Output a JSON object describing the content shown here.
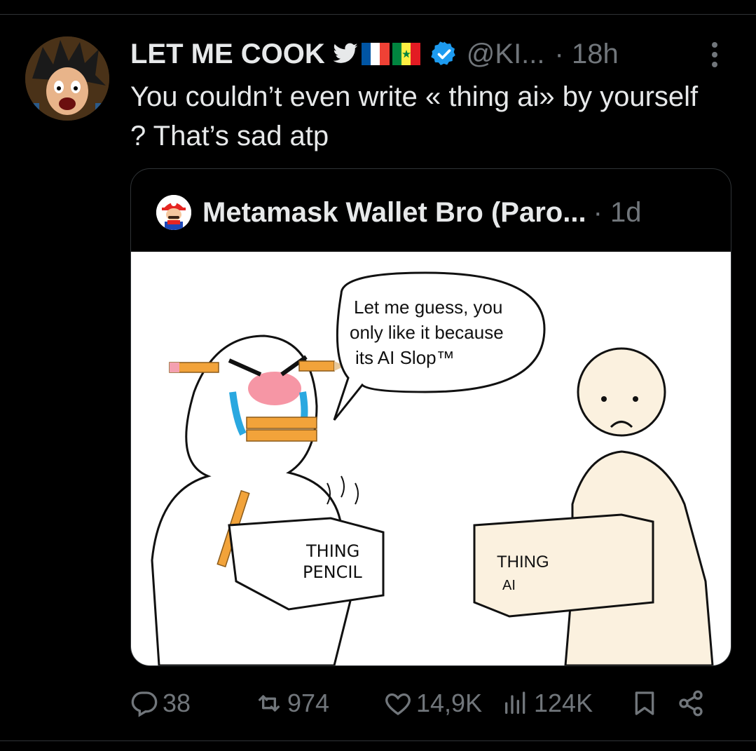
{
  "post": {
    "author_name": "LET ME COOK",
    "handle": "@KI...",
    "time": "· 18h",
    "text": "You couldn’t even write « thing ai» by yourself ? That’s sad atp"
  },
  "quote": {
    "author_name": "Metamask Wallet Bro (Paro...",
    "time": "· 1d",
    "comic": {
      "speech": [
        "Let me guess, you",
        "only like it because",
        "its AI Slop™"
      ],
      "left_box_line1": "THING",
      "left_box_line2": "PENCIL",
      "right_box_line1": "THING",
      "right_box_line2": "AI"
    }
  },
  "actions": {
    "replies": "38",
    "reposts": "974",
    "likes": "14,9K",
    "views": "124K"
  },
  "colors": {
    "background": "#000000",
    "text": "#e7e9ea",
    "muted": "#71767b",
    "verified": "#1d9bf0",
    "border": "#2f3336"
  },
  "icons": [
    "twitter-bird-icon",
    "france-flag-icon",
    "senegal-flag-icon",
    "verified-badge-icon",
    "more-icon",
    "reply-icon",
    "repost-icon",
    "like-icon",
    "views-icon",
    "bookmark-icon",
    "share-icon"
  ]
}
